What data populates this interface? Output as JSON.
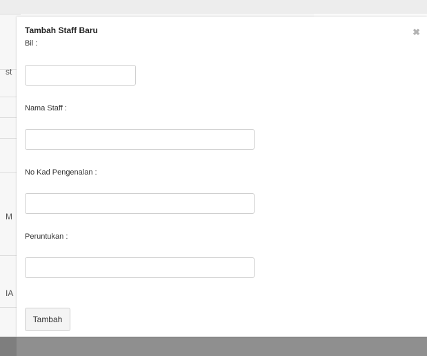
{
  "modal": {
    "title": "Tambah Staff Baru",
    "close_icon": "close-icon",
    "fields": {
      "bil": {
        "label": "Bil :",
        "value": "",
        "placeholder": ""
      },
      "nama_staff": {
        "label": "Nama Staff :",
        "value": "",
        "placeholder": ""
      },
      "no_kad": {
        "label": "No Kad Pengenalan :",
        "value": "",
        "placeholder": ""
      },
      "peruntukan": {
        "label": "Peruntukan :",
        "value": "",
        "placeholder": ""
      }
    },
    "submit_label": "Tambah"
  },
  "background": {
    "fragments": [
      "st",
      "M",
      "IA"
    ]
  }
}
